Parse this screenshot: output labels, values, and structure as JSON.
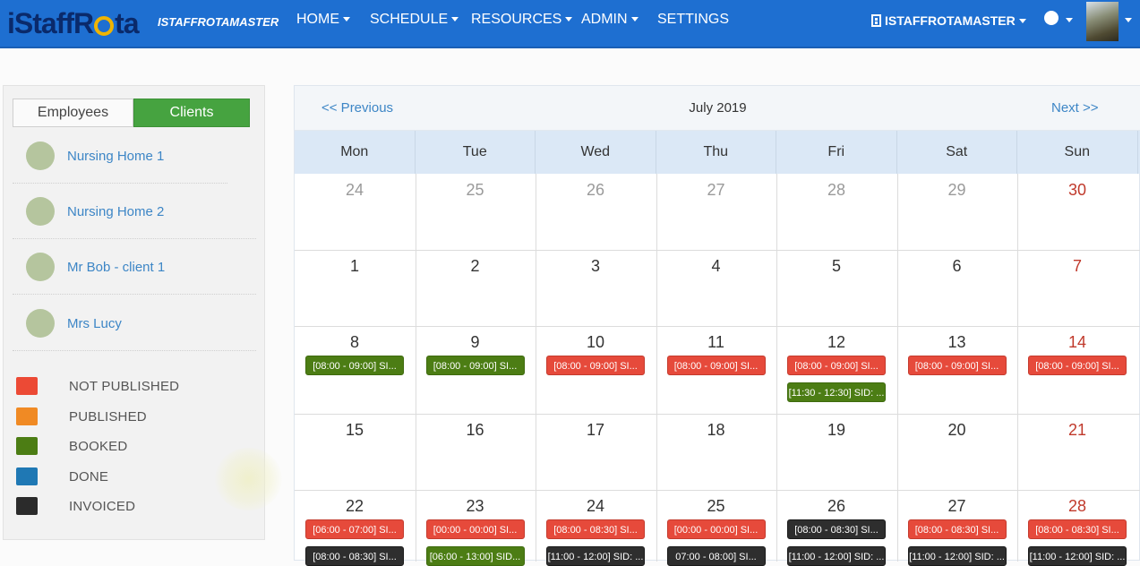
{
  "brand": {
    "logo_text_left": "iStaffR",
    "logo_text_right": "ta",
    "account_label": "ISTAFFROTAMASTER"
  },
  "nav": [
    {
      "label": "HOME"
    },
    {
      "label": "SCHEDULE"
    },
    {
      "label": "RESOURCES"
    },
    {
      "label": "ADMIN"
    },
    {
      "label": "SETTINGS"
    }
  ],
  "user_menu": {
    "label": "ISTAFFROTAMASTER"
  },
  "tabs": {
    "employees": "Employees",
    "clients": "Clients"
  },
  "clients": [
    {
      "name": "Nursing Home 1"
    },
    {
      "name": "Nursing Home 2"
    },
    {
      "name": "Mr Bob - client 1"
    },
    {
      "name": "Mrs Lucy"
    }
  ],
  "legend": [
    {
      "label": "NOT PUBLISHED",
      "color": "#ec4a35"
    },
    {
      "label": "PUBLISHED",
      "color": "#f08a24"
    },
    {
      "label": "BOOKED",
      "color": "#4c7d14"
    },
    {
      "label": "DONE",
      "color": "#1f78b4"
    },
    {
      "label": "INVOICED",
      "color": "#2b2b2b"
    }
  ],
  "calendar": {
    "prev_label": "<<  Previous",
    "next_label": "Next  >>",
    "month": "July 2019",
    "weekdays": [
      "Mon",
      "Tue",
      "Wed",
      "Thu",
      "Fri",
      "Sat",
      "Sun"
    ],
    "weeks": [
      {
        "days": [
          "24",
          "25",
          "26",
          "27",
          "28",
          "29",
          "30"
        ],
        "muted": [
          true,
          true,
          true,
          true,
          true,
          true,
          false
        ]
      },
      {
        "days": [
          "1",
          "2",
          "3",
          "4",
          "5",
          "6",
          "7"
        ]
      },
      {
        "days": [
          "8",
          "9",
          "10",
          "11",
          "12",
          "13",
          "14"
        ]
      },
      {
        "days": [
          "15",
          "16",
          "17",
          "18",
          "19",
          "20",
          "21"
        ]
      },
      {
        "days": [
          "22",
          "23",
          "24",
          "25",
          "26",
          "27",
          "28"
        ]
      }
    ],
    "events": [
      {
        "week": 2,
        "day": 0,
        "slot": 0,
        "text": "[08:00 - 09:00] SI...",
        "status": "green"
      },
      {
        "week": 2,
        "day": 1,
        "slot": 0,
        "text": "[08:00 - 09:00] SI...",
        "status": "green"
      },
      {
        "week": 2,
        "day": 2,
        "slot": 0,
        "text": "[08:00 - 09:00] SI...",
        "status": "red"
      },
      {
        "week": 2,
        "day": 3,
        "slot": 0,
        "text": "[08:00 - 09:00] SI...",
        "status": "red"
      },
      {
        "week": 2,
        "day": 4,
        "slot": 0,
        "text": "[08:00 - 09:00] SI...",
        "status": "red"
      },
      {
        "week": 2,
        "day": 4,
        "slot": 1,
        "text": "[11:30 - 12:30] SID: ...",
        "status": "green"
      },
      {
        "week": 2,
        "day": 5,
        "slot": 0,
        "text": "[08:00 - 09:00] SI...",
        "status": "red"
      },
      {
        "week": 2,
        "day": 6,
        "slot": 0,
        "text": "[08:00 - 09:00] SI...",
        "status": "red"
      },
      {
        "week": 4,
        "day": 0,
        "slot": 0,
        "text": "[06:00 - 07:00] SI...",
        "status": "red"
      },
      {
        "week": 4,
        "day": 0,
        "slot": 1,
        "text": "[08:00 - 08:30] SI...",
        "status": "black"
      },
      {
        "week": 4,
        "day": 1,
        "slot": 0,
        "text": "[00:00 - 00:00] SI...",
        "status": "red"
      },
      {
        "week": 4,
        "day": 1,
        "slot": 1,
        "text": "[06:00 - 13:00] SID...",
        "status": "green"
      },
      {
        "week": 4,
        "day": 2,
        "slot": 0,
        "text": "[08:00 - 08:30] SI...",
        "status": "red"
      },
      {
        "week": 4,
        "day": 2,
        "slot": 1,
        "text": "[11:00 - 12:00] SID: ...",
        "status": "black"
      },
      {
        "week": 4,
        "day": 3,
        "slot": 0,
        "text": "[00:00 - 00:00] SI...",
        "status": "red"
      },
      {
        "week": 4,
        "day": 3,
        "slot": 1,
        "text": "07:00 - 08:00] SI...",
        "status": "black"
      },
      {
        "week": 4,
        "day": 4,
        "slot": 0,
        "text": "[08:00 - 08:30] SI...",
        "status": "black"
      },
      {
        "week": 4,
        "day": 4,
        "slot": 1,
        "text": "[11:00 - 12:00] SID: ...",
        "status": "black"
      },
      {
        "week": 4,
        "day": 5,
        "slot": 0,
        "text": "[08:00 - 08:30] SI...",
        "status": "red"
      },
      {
        "week": 4,
        "day": 5,
        "slot": 1,
        "text": "[11:00 - 12:00] SID: ...",
        "status": "black"
      },
      {
        "week": 4,
        "day": 6,
        "slot": 0,
        "text": "[08:00 - 08:30] SI...",
        "status": "red"
      },
      {
        "week": 4,
        "day": 6,
        "slot": 1,
        "text": "[11:00 - 12:00] SID: ...",
        "status": "black"
      }
    ]
  }
}
